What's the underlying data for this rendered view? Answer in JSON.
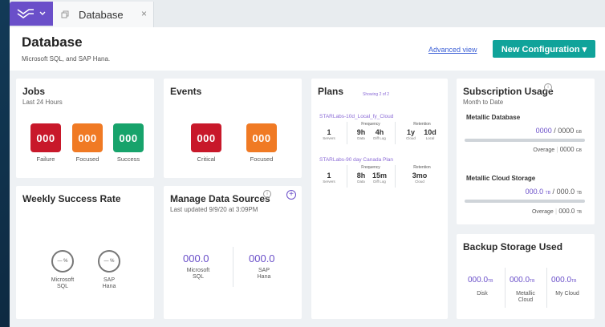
{
  "tab": {
    "label": "Database",
    "close": "×"
  },
  "header": {
    "title": "Database",
    "subtitle": "Microsoft SQL, and SAP Hana.",
    "advanced_view": "Advanced view",
    "new_config": "New Configuration ▾"
  },
  "jobs": {
    "title": "Jobs",
    "subtitle": "Last 24 Hours",
    "tiles": [
      {
        "value": "000",
        "label": "Failure",
        "color": "#c8182a"
      },
      {
        "value": "000",
        "label": "Focused",
        "color": "#f07a24"
      },
      {
        "value": "000",
        "label": "Success",
        "color": "#17a36b"
      }
    ]
  },
  "events": {
    "title": "Events",
    "tiles": [
      {
        "value": "000",
        "label": "Critical",
        "color": "#c8182a"
      },
      {
        "value": "000",
        "label": "Focused",
        "color": "#f07a24"
      }
    ]
  },
  "plans": {
    "title": "Plans",
    "showing": "Showing 2 of 2",
    "items": [
      {
        "name": "STARLabs-10d_Local_fy_Cloud",
        "servers": "1",
        "servers_cap": "Servers",
        "freq_head": "Frequency",
        "data": "9h",
        "data_cap": "Data",
        "diff": "4h",
        "diff_cap": "Diff Log",
        "ret_head": "Retention",
        "cloud": "1y",
        "cloud_cap": "Cloud",
        "local": "10d",
        "local_cap": "Local"
      },
      {
        "name": "STARLabs-90 day Canada Plan",
        "servers": "1",
        "servers_cap": "Servers",
        "freq_head": "Frequency",
        "data": "8h",
        "data_cap": "Data",
        "diff": "15m",
        "diff_cap": "Diff Log",
        "ret_head": "Retention",
        "cloud": "3mo",
        "cloud_cap": "Cloud"
      }
    ]
  },
  "subscription": {
    "title": "Subscription Usage",
    "subtitle": "Month to Date",
    "db_title": "Metallic Database",
    "db_used": "0000",
    "db_total": "0000",
    "db_unit": "GB",
    "db_overage_label": "Overage",
    "db_overage": "0000",
    "db_overage_unit": "GB",
    "cloud_title": "Metallic Cloud Storage",
    "cloud_used": "000.0",
    "cloud_used_unit": "TB",
    "cloud_total": "000.0",
    "cloud_total_unit": "TB",
    "cloud_overage_label": "Overage",
    "cloud_overage": "000.0",
    "cloud_overage_unit": "TB"
  },
  "weekly": {
    "title": "Weekly Success Rate",
    "items": [
      {
        "value": "— %",
        "label1": "Microsoft",
        "label2": "SQL"
      },
      {
        "value": "— %",
        "label1": "SAP",
        "label2": "Hana"
      }
    ]
  },
  "sources": {
    "title": "Manage Data Sources",
    "subtitle": "Last updated 9/9/20 at 3:09PM",
    "items": [
      {
        "value": "000.0",
        "label1": "Microsoft",
        "label2": "SQL"
      },
      {
        "value": "000.0",
        "label1": "SAP",
        "label2": "Hana"
      }
    ]
  },
  "backup": {
    "title": "Backup Storage Used",
    "items": [
      {
        "value": "000.0",
        "unit": "TB",
        "label1": "Disk",
        "label2": ""
      },
      {
        "value": "000.0",
        "unit": "TB",
        "label1": "Metallic",
        "label2": "Cloud"
      },
      {
        "value": "000.0",
        "unit": "TB",
        "label1": "My Cloud",
        "label2": ""
      }
    ]
  }
}
